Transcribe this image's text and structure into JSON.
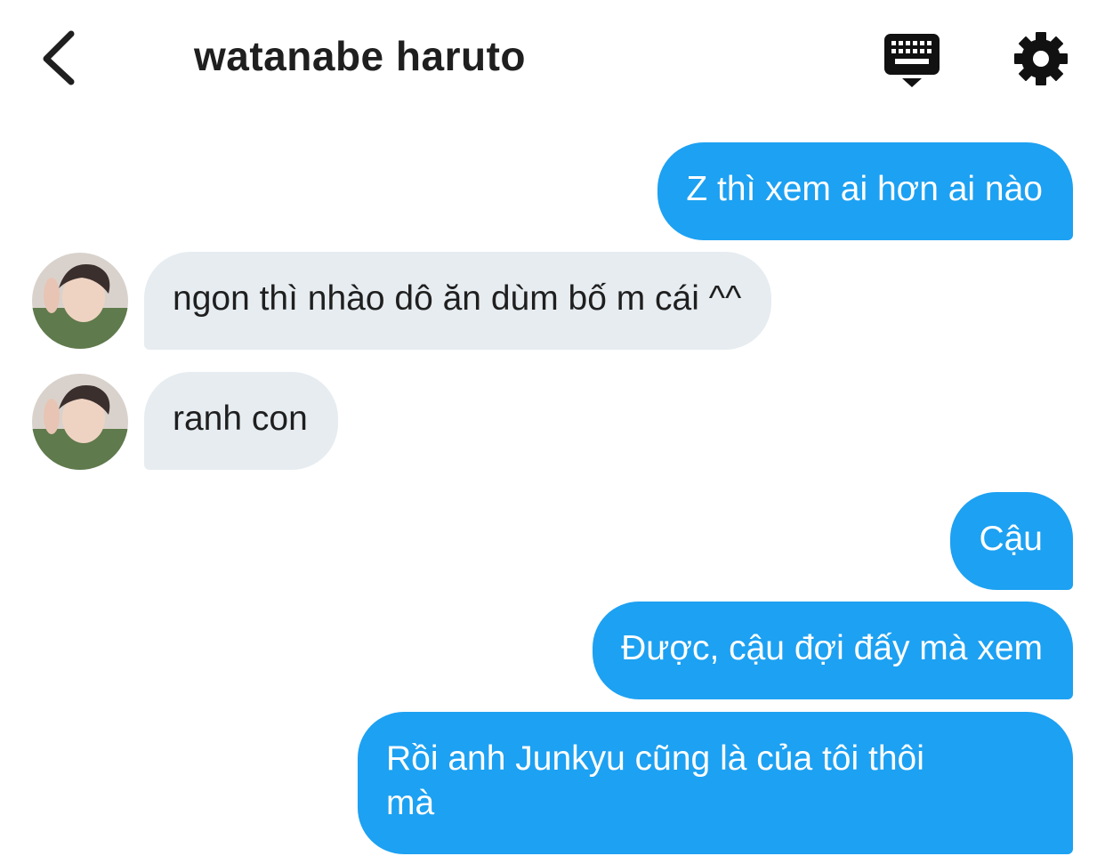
{
  "header": {
    "title": "watanabe haruto"
  },
  "messages": [
    {
      "side": "sent",
      "text": "Z thì xem ai hơn ai nào"
    },
    {
      "side": "recv",
      "text": "ngon thì nhào dô ăn dùm bố m cái ^^"
    },
    {
      "side": "recv",
      "text": "ranh con"
    },
    {
      "side": "sent",
      "text": "Cậu"
    },
    {
      "side": "sent",
      "text": "Được, cậu đợi đấy mà xem"
    },
    {
      "side": "sent",
      "text": "Rồi anh Junkyu cũng là của tôi thôi\nmà"
    }
  ],
  "colors": {
    "sent_bubble": "#1da1f2",
    "recv_bubble": "#e6ecf0",
    "title": "#1f1f1f"
  },
  "icons": {
    "back": "chevron-left-icon",
    "keyboard": "keyboard-icon",
    "settings": "gear-icon"
  }
}
